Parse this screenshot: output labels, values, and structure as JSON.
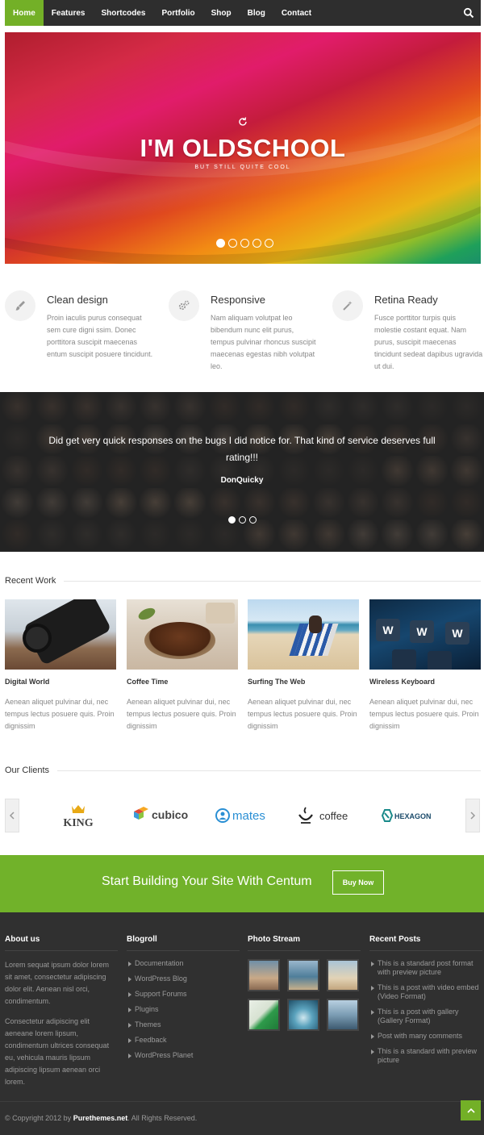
{
  "nav": {
    "items": [
      {
        "label": "Home",
        "active": true
      },
      {
        "label": "Features"
      },
      {
        "label": "Shortcodes"
      },
      {
        "label": "Portfolio"
      },
      {
        "label": "Shop"
      },
      {
        "label": "Blog"
      },
      {
        "label": "Contact"
      }
    ],
    "search_icon": "search-icon"
  },
  "hero": {
    "title": "I'M OLDSCHOOL",
    "subtitle": "BUT STILL QUITE COOL",
    "slide_count": 5,
    "active_slide": 1
  },
  "features": [
    {
      "icon": "brush-icon",
      "title": "Clean design",
      "text": "Proin iaculis purus consequat sem cure digni ssim. Donec porttitora suscipit maecenas entum suscipit posuere tincidunt."
    },
    {
      "icon": "gears-icon",
      "title": "Responsive",
      "text": "Nam aliquam volutpat leo bibendum nunc elit purus, tempus pulvinar rhoncus suscipit maecenas egestas nibh volutpat leo."
    },
    {
      "icon": "magic-wand-icon",
      "title": "Retina Ready",
      "text": "Fusce porttitor turpis quis molestie costant equat. Nam purus, suscipit maecenas tincidunt sedeat dapibus ugravida ut dui."
    }
  ],
  "testimonial": {
    "quote": "Did get very quick responses on the bugs I did notice for. That kind of service deserves full rating!!!",
    "author": "DonQuicky",
    "slide_count": 3,
    "active_slide": 1
  },
  "recent_work": {
    "heading": "Recent Work",
    "items": [
      {
        "title": "Digital World",
        "text": "Aenean aliquet pulvinar dui, nec tempus lectus posuere quis. Proin dignissim"
      },
      {
        "title": "Coffee Time",
        "text": "Aenean aliquet pulvinar dui, nec tempus lectus posuere quis. Proin dignissim"
      },
      {
        "title": "Surfing The Web",
        "text": "Aenean aliquet pulvinar dui, nec tempus lectus posuere quis. Proin dignissim"
      },
      {
        "title": "Wireless Keyboard",
        "text": "Aenean aliquet pulvinar dui, nec tempus lectus posuere quis. Proin dignissim"
      }
    ]
  },
  "clients": {
    "heading": "Our Clients",
    "logos": [
      "KING",
      "cubico",
      "mates",
      "coffee",
      "HEXAGON"
    ]
  },
  "cta": {
    "text": "Start Building Your Site With Centum",
    "button": "Buy Now"
  },
  "footer": {
    "about": {
      "title": "About us",
      "p1": "Lorem sequat ipsum dolor lorem sit amet, consectetur adipiscing dolor elit. Aenean nisl orci, condimentum.",
      "p2": "Consectetur adipiscing elit aeneane lorem lipsum, condimentum ultrices consequat eu, vehicula mauris lipsum adipiscing lipsum aenean orci lorem."
    },
    "blogroll": {
      "title": "Blogroll",
      "items": [
        "Documentation",
        "WordPress Blog",
        "Support Forums",
        "Plugins",
        "Themes",
        "Feedback",
        "WordPress Planet"
      ]
    },
    "photos": {
      "title": "Photo Stream"
    },
    "recent": {
      "title": "Recent Posts",
      "items": [
        "This is a standard post format with preview picture",
        "This is a post with video embed (Video Format)",
        "This is a post with gallery (Gallery Format)",
        "Post with many comments",
        "This is a standard with preview picture"
      ]
    },
    "copyright_prefix": "© Copyright 2012 by ",
    "copyright_brand": "Purethemes.net",
    "copyright_suffix": ". All Rights Reserved."
  },
  "colors": {
    "accent": "#73b027",
    "nav_bg": "#2e2e2e",
    "footer_bg": "#303030"
  }
}
